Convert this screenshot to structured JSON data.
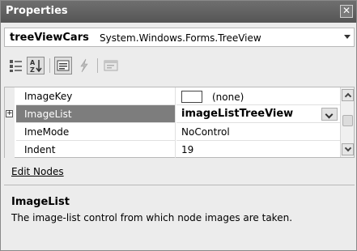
{
  "window": {
    "title": "Properties",
    "close_glyph": "✕"
  },
  "object_selector": {
    "name": "treeViewCars",
    "type": "System.Windows.Forms.TreeView"
  },
  "toolbar": {
    "buttons": [
      {
        "icon": "categorized-icon",
        "pressed": false
      },
      {
        "icon": "alphabetical-sort-icon",
        "pressed": true
      },
      {
        "icon": "properties-icon",
        "pressed": true
      },
      {
        "icon": "events-lightning-icon",
        "pressed": false
      },
      {
        "icon": "property-pages-icon",
        "pressed": false
      }
    ]
  },
  "grid": {
    "rows": [
      {
        "name": "ImageKey",
        "value": "(none)"
      },
      {
        "name": "ImageList",
        "value": "imageListTreeView",
        "expand_glyph": "+"
      },
      {
        "name": "ImeMode",
        "value": "NoControl"
      },
      {
        "name": "Indent",
        "value": "19"
      }
    ]
  },
  "commands": {
    "edit_nodes": "Edit Nodes"
  },
  "description": {
    "title": "ImageList",
    "text": "The image-list control from which node images are taken."
  },
  "colors": {
    "titlebar": "#5f5f5f",
    "selection": "#7d7d7d",
    "panel": "#ececec"
  }
}
